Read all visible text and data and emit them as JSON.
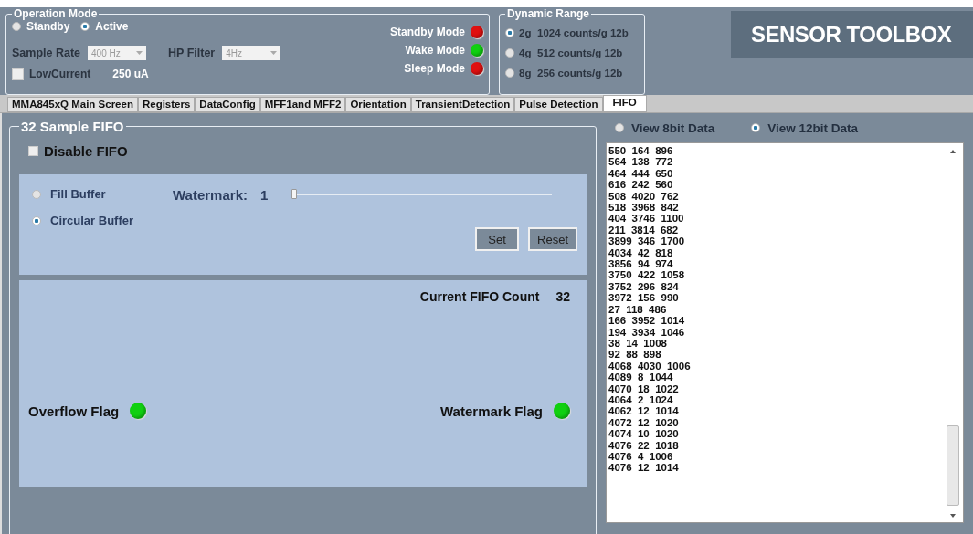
{
  "operation_mode": {
    "title": "Operation Mode",
    "modes": [
      {
        "label": "Standby",
        "selected": false
      },
      {
        "label": "Active",
        "selected": true
      }
    ],
    "sample_rate": {
      "label": "Sample Rate",
      "value": "400 Hz",
      "disabled": true
    },
    "hp_filter": {
      "label": "HP Filter",
      "value": "4Hz",
      "disabled": true
    },
    "low_current": {
      "label": "LowCurrent",
      "checked": false
    },
    "current_reading": "250  uA",
    "status_lights": [
      {
        "label": "Standby Mode",
        "color": "#e01010"
      },
      {
        "label": "Wake Mode",
        "color": "#10d010"
      },
      {
        "label": "Sleep Mode",
        "color": "#e01010"
      }
    ]
  },
  "dynamic_range": {
    "title": "Dynamic Range",
    "options": [
      {
        "range": "2g",
        "counts": "1024 counts/g 12b",
        "selected": true
      },
      {
        "range": "4g",
        "counts": "512 counts/g 12b",
        "selected": false
      },
      {
        "range": "8g",
        "counts": "256 counts/g 12b",
        "selected": false
      }
    ]
  },
  "banner": "SENSOR TOOLBOX",
  "tabs": [
    {
      "label": "MMA845xQ Main Screen",
      "selected": false
    },
    {
      "label": "Registers",
      "selected": false
    },
    {
      "label": "DataConfig",
      "selected": false
    },
    {
      "label": "MFF1and MFF2",
      "selected": false
    },
    {
      "label": "Orientation",
      "selected": false
    },
    {
      "label": "TransientDetection",
      "selected": false
    },
    {
      "label": "Pulse Detection",
      "selected": false
    },
    {
      "label": "FIFO",
      "selected": true
    }
  ],
  "fifo": {
    "title": "32 Sample FIFO",
    "disable_fifo": {
      "label": "Disable FIFO",
      "checked": false
    },
    "buffer_modes": [
      {
        "label": "Fill Buffer",
        "selected": false
      },
      {
        "label": "Circular Buffer",
        "selected": true
      }
    ],
    "watermark": {
      "label": "Watermark:",
      "value": "1",
      "level": 0
    },
    "buttons": [
      "Set",
      "Reset"
    ],
    "count_label": "Current FIFO Count",
    "count": "32",
    "flags": [
      {
        "label": "Overflow Flag",
        "color": "#10d010"
      },
      {
        "label": "Watermark Flag",
        "color": "#10d010"
      }
    ]
  },
  "view": {
    "options": [
      {
        "label": "View 8bit Data",
        "selected": false
      },
      {
        "label": "View 12bit Data",
        "selected": true
      }
    ],
    "lines": [
      "550  164  896",
      "564  138  772",
      "464  444  650",
      "616  242  560",
      "508  4020  762",
      "518  3968  842",
      "404  3746  1100",
      "211  3814  682",
      "3899  346  1700",
      "4034  42  818",
      "3856  94  974",
      "3750  422  1058",
      "3752  296  824",
      "3972  156  990",
      "27  118  486",
      "166  3952  1014",
      "194  3934  1046",
      "38  14  1008",
      "92  88  898",
      "4068  4030  1006",
      "4089  8  1044",
      "4070  18  1022",
      "4064  2  1024",
      "4062  12  1014",
      "4072  12  1020",
      "4074  10  1020",
      "4076  22  1018",
      "4076  4  1006",
      "4076  12  1014"
    ]
  }
}
